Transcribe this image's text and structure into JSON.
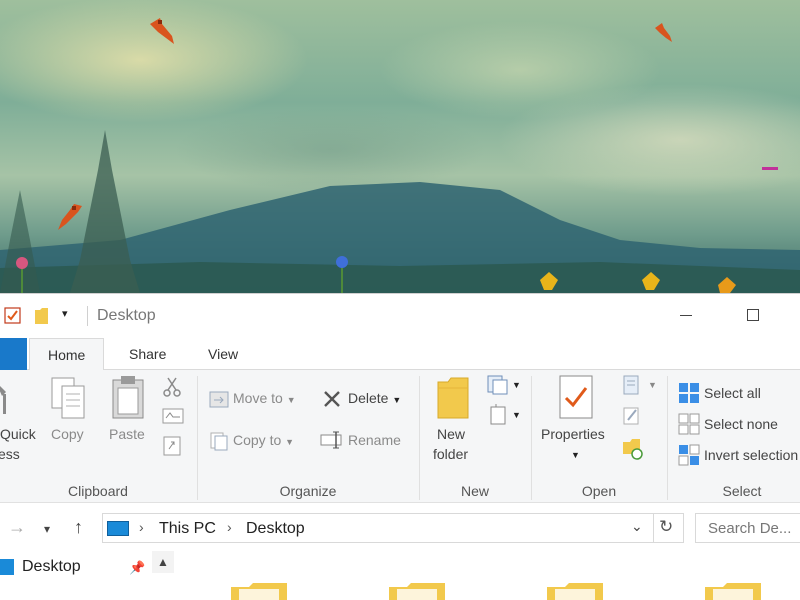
{
  "window": {
    "title": "Desktop"
  },
  "tabs": {
    "home": "Home",
    "share": "Share",
    "view": "View"
  },
  "ribbon": {
    "clipboard": {
      "pin_label_1": "Quick",
      "pin_label_2": "ess",
      "copy": "Copy",
      "paste": "Paste",
      "group": "Clipboard"
    },
    "organize": {
      "move_to": "Move to",
      "copy_to": "Copy to",
      "delete": "Delete",
      "rename": "Rename",
      "group": "Organize"
    },
    "new": {
      "new_folder_1": "New",
      "new_folder_2": "folder",
      "group": "New"
    },
    "open": {
      "properties": "Properties",
      "group": "Open"
    },
    "select": {
      "select_all": "Select all",
      "select_none": "Select none",
      "invert_selection": "Invert selection",
      "group": "Select"
    }
  },
  "address_bar": {
    "crumbs": [
      "This PC",
      "Desktop"
    ],
    "search_placeholder": "Search De..."
  },
  "nav_pane": {
    "pinned_item": "Desktop"
  },
  "colors": {
    "accent": "#1979ca",
    "folder": "#f2c94c"
  }
}
